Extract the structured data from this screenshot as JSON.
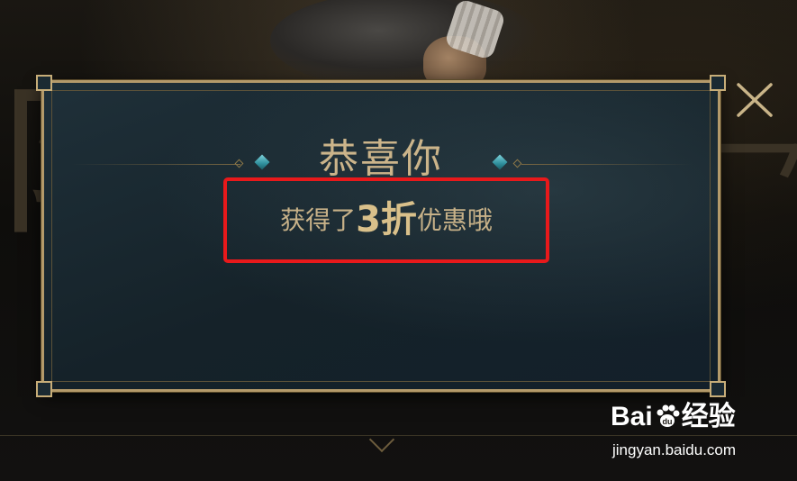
{
  "dialog": {
    "title": "恭喜你",
    "message_prefix": "获得了",
    "discount": "3折",
    "message_suffix": "优惠哦"
  },
  "colors": {
    "accent_gold": "#cbb48a",
    "highlight_box": "#e8191b",
    "dialog_bg": "#1a2a32",
    "diamond_teal": "#2f8f9c"
  },
  "icons": {
    "close": "close-icon",
    "title_ornament": "diamond-icon"
  },
  "watermark": {
    "brand_left": "Bai",
    "brand_right": "经验",
    "url": "jingyan.baidu.com"
  }
}
